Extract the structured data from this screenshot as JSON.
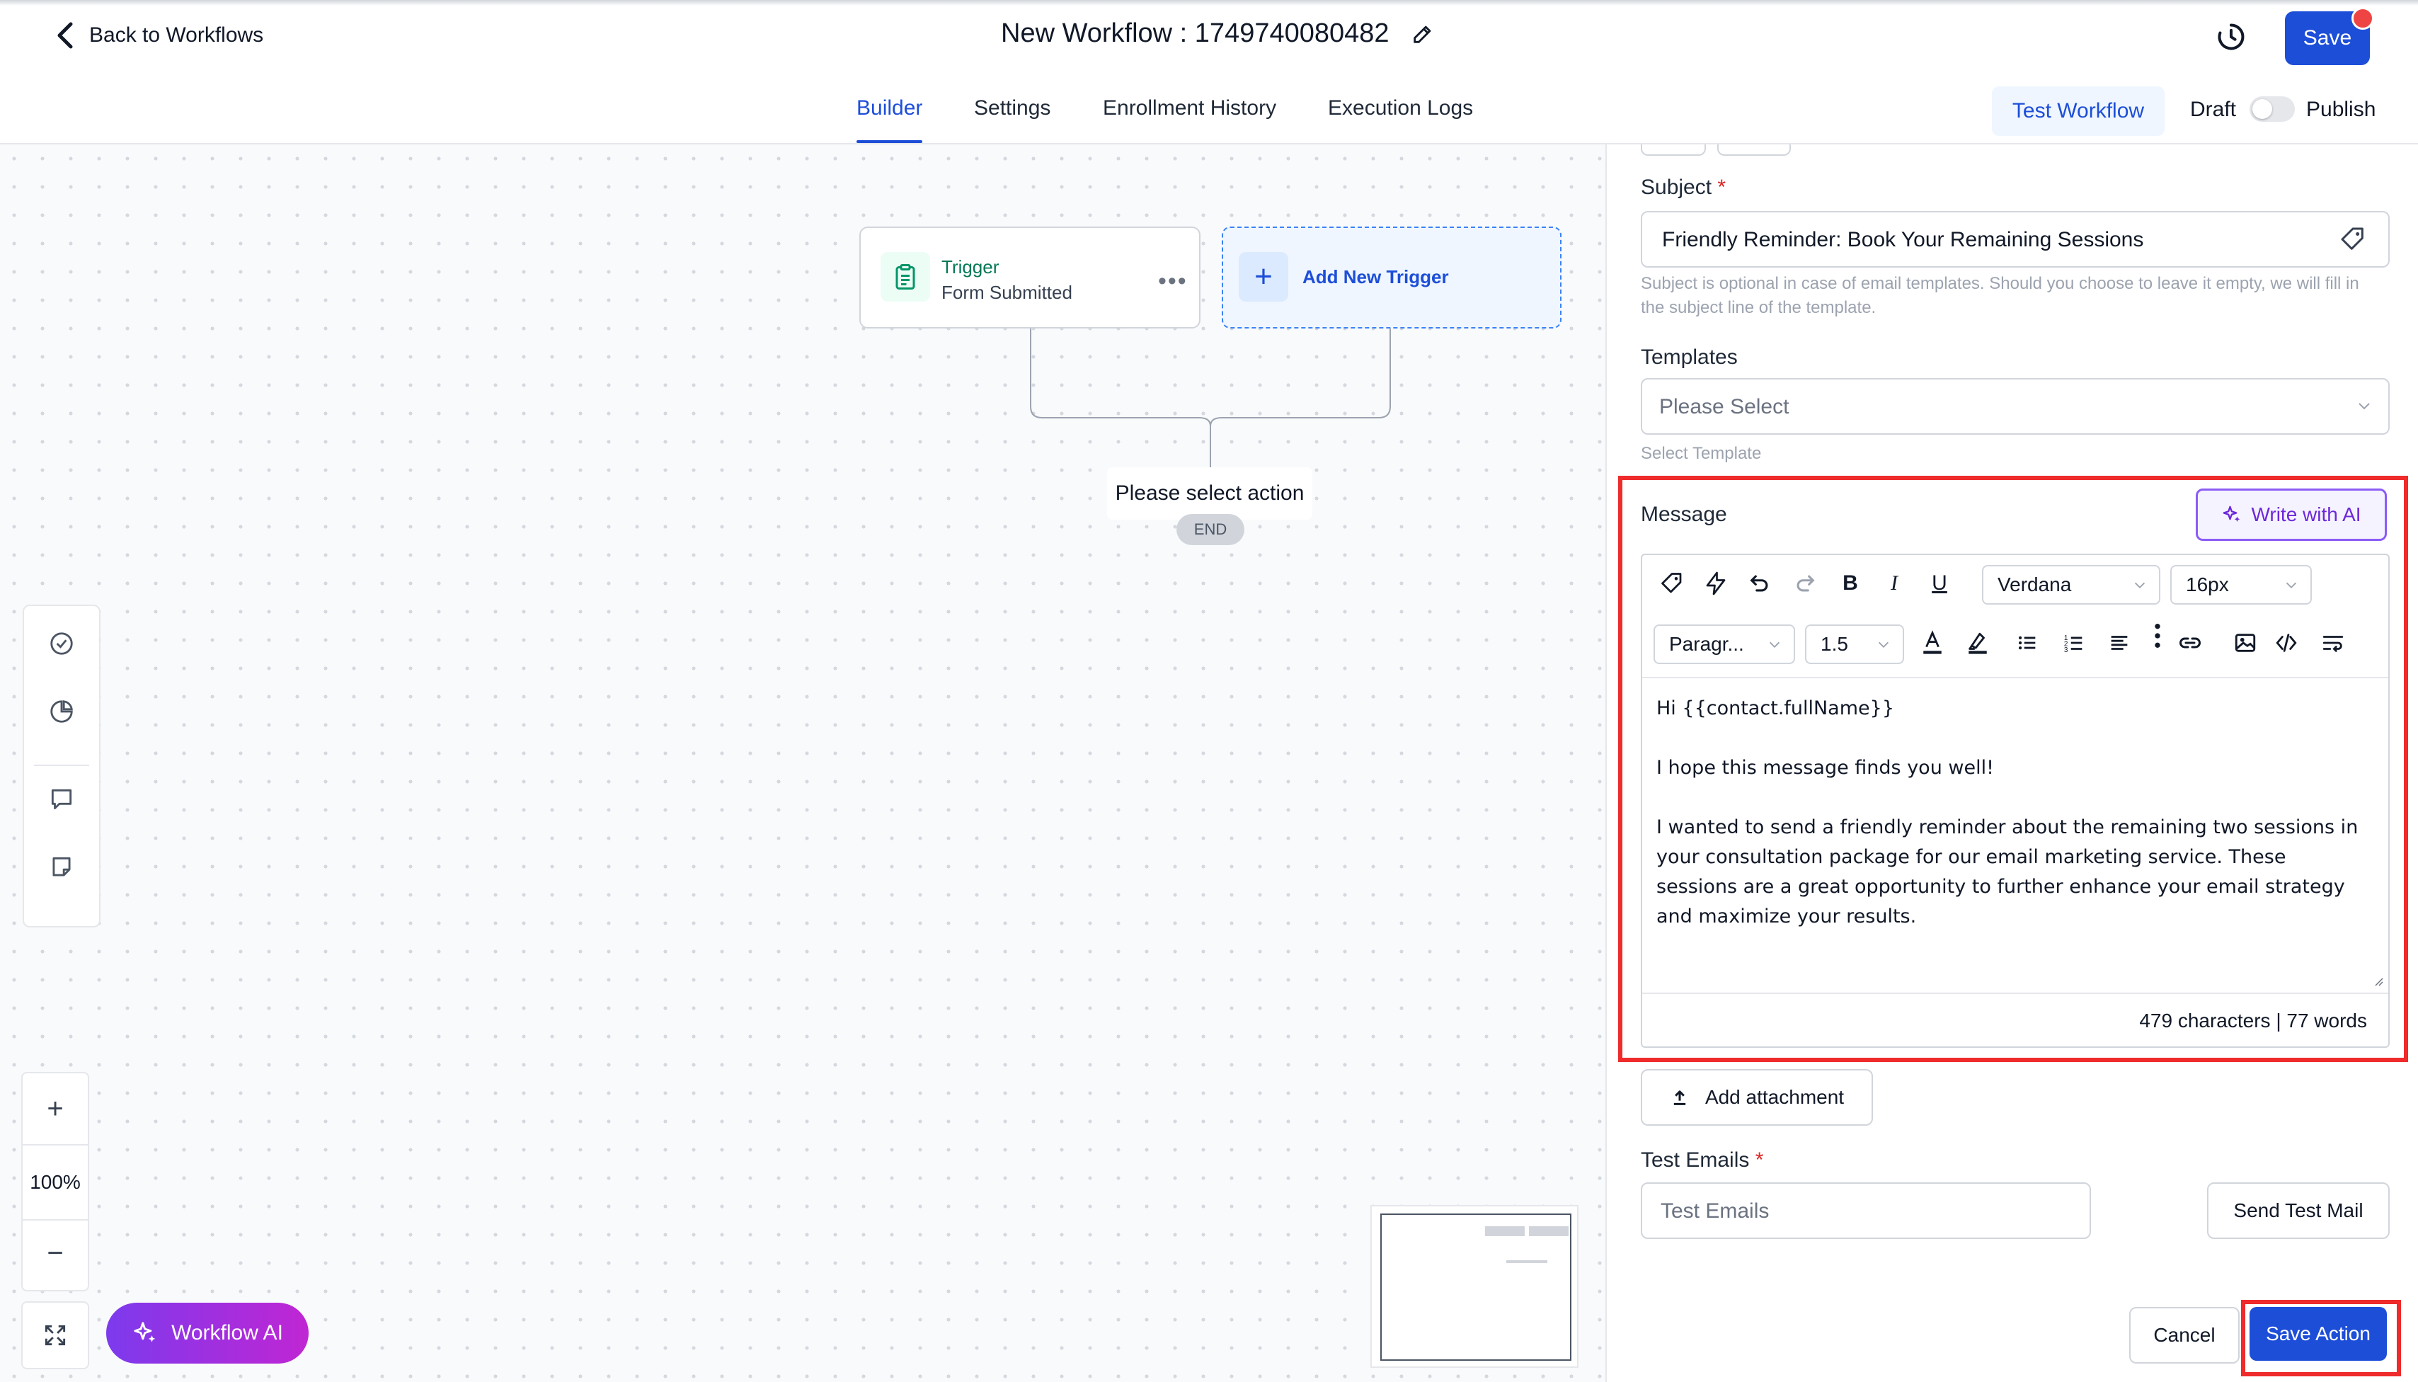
{
  "header": {
    "back_label": "Back to Workflows",
    "title": "New Workflow : 1749740080482",
    "save_label": "Save"
  },
  "tabs": [
    {
      "label": "Builder",
      "active": true
    },
    {
      "label": "Settings",
      "active": false
    },
    {
      "label": "Enrollment History",
      "active": false
    },
    {
      "label": "Execution Logs",
      "active": false
    }
  ],
  "toolbar_right": {
    "test_workflow_label": "Test Workflow",
    "draft_label": "Draft",
    "publish_label": "Publish",
    "published": false
  },
  "canvas": {
    "trigger": {
      "title": "Trigger",
      "subtitle": "Form Submitted"
    },
    "add_trigger_label": "Add New Trigger",
    "select_action_label": "Please select action",
    "end_label": "END",
    "zoom_level": "100%",
    "workflow_ai_label": "Workflow AI"
  },
  "panel": {
    "subject": {
      "label": "Subject",
      "required_mark": "*",
      "value": "Friendly Reminder: Book Your Remaining Sessions",
      "hint": "Subject is optional in case of email templates. Should you choose to leave it empty, we will fill in the subject line of the template."
    },
    "templates": {
      "label": "Templates",
      "placeholder": "Please Select",
      "hint": "Select Template"
    },
    "message": {
      "label": "Message",
      "write_ai_label": "Write with AI",
      "font_family": "Verdana",
      "font_size": "16px",
      "block_format": "Paragr...",
      "line_height": "1.5",
      "body": [
        "Hi {{contact.fullName}}",
        "I hope this message finds you well!",
        "I wanted to send a friendly reminder about the remaining two sessions in your consultation package for our email marketing service. These sessions are a great opportunity to further enhance your email strategy and maximize your results."
      ],
      "counter": "479 characters | 77 words"
    },
    "add_attachment_label": "Add attachment",
    "test_emails": {
      "label": "Test Emails",
      "required_mark": "*",
      "placeholder": "Test Emails",
      "send_label": "Send Test Mail"
    },
    "cancel_label": "Cancel",
    "save_action_label": "Save Action"
  },
  "colors": {
    "primary": "#1d4ed8",
    "highlight": "#ef2b2b",
    "ai_purple": "#7c3aed",
    "trigger_green": "#047857"
  }
}
